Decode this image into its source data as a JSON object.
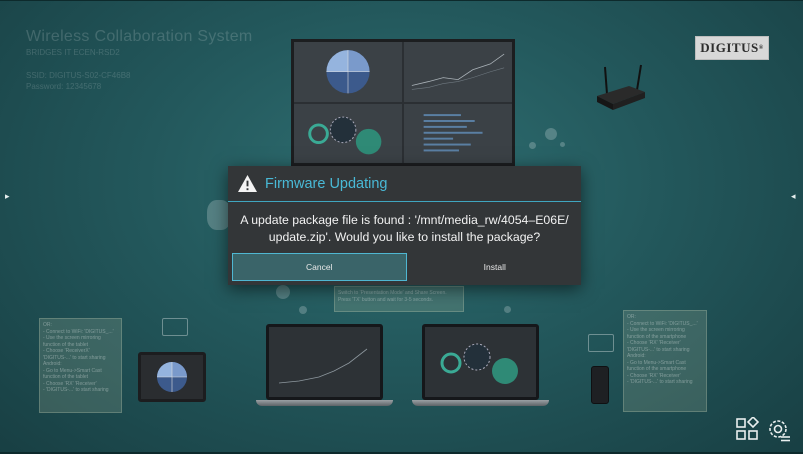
{
  "background": {
    "title": "Wireless Collaboration System",
    "subtitle": "BRIDGES IT ECEN-RSD2",
    "ssid": "SSID: DIGITUS-S02-CF46B8",
    "password": "Password: 12345678",
    "logo_text": "DIGITUS",
    "logo_mark": "®"
  },
  "cards": {
    "left_card": "OR:\n- Connect to WiFi: 'DIGITUS_...'\n- Use the screen mirroring function of the tablet\n- Choose 'ReceiverX' 'DIGITUS-...' to start sharing\nAndroid:\n- Go to Menu->Smart Cast function of the tablet\n- Choose 'RX' 'Receiver'\n- 'DIGITUS-...' to start sharing",
    "center_card": "Switch to 'Presentation Mode' and Share Screen. Press 'TX' button and wait for 3-5 seconds.",
    "right_card": "OR:\n- Connect to WiFi: 'DIGITUS_...'\n- Use the screen mirroring function of the smartphone\n- Choose 'RX' 'Receiver' 'DIGITUS-...' to start sharing\nAndroid:\n- Go to Menu->Smart Cast function of the smartphone\n- Choose 'RX' 'Receiver'\n- 'DIGITUS-...' to start sharing"
  },
  "dialog": {
    "title": "Firmware Updating",
    "message": "A update package file is found : '/mnt/media_rw/4054–E06E/ update.zip'. Would you like to install the package?",
    "cancel_label": "Cancel",
    "install_label": "Install",
    "accent_color": "#49b9d6"
  },
  "icons": {
    "left_arrow": "▸",
    "right_arrow": "◂",
    "apps": "apps-icon",
    "settings": "settings-icon",
    "warning": "warning-icon"
  }
}
